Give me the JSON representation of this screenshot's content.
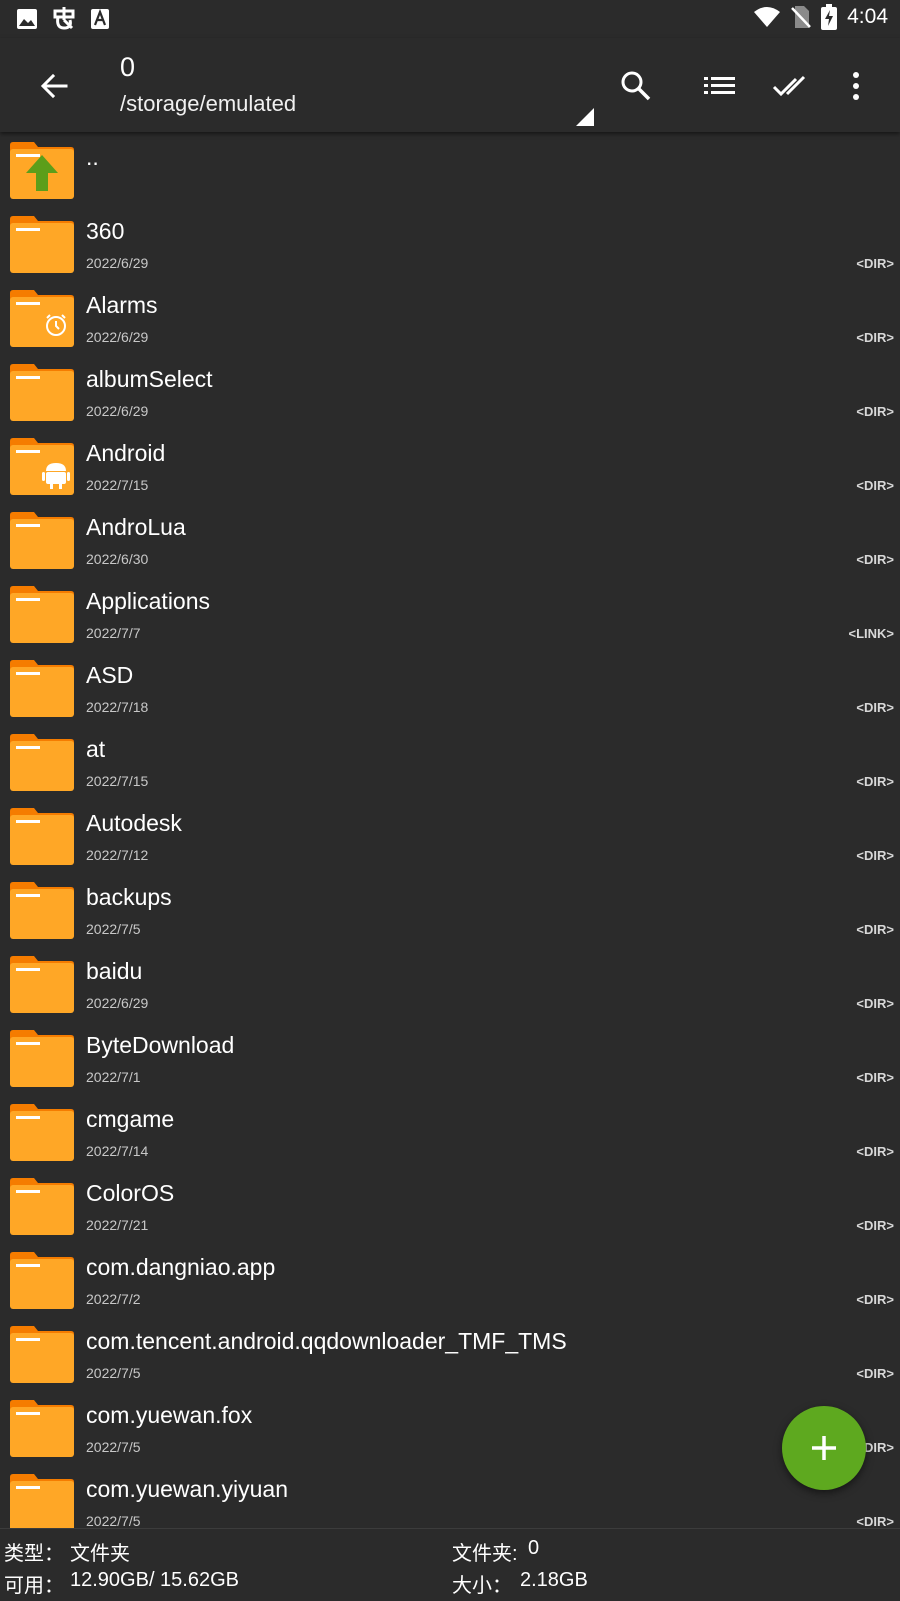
{
  "status": {
    "time": "4:04",
    "left_icons": [
      "image-icon",
      "bug-icon",
      "a-icon"
    ],
    "right_icons": [
      "wifi-icon",
      "no-sim-icon",
      "battery-charging-icon"
    ]
  },
  "appbar": {
    "title": "0",
    "path": "/storage/emulated",
    "actions": [
      "search-icon",
      "list-view-icon",
      "select-all-icon",
      "more-vert-icon"
    ]
  },
  "colors": {
    "background": "#2b2b2b",
    "folder": "#ffa726",
    "folder_tab": "#f57c00",
    "fab": "#5ea91f",
    "up_arrow": "#5c9e1a"
  },
  "files": [
    {
      "name": "..",
      "date": "",
      "type": "",
      "icon": "folder-up-icon"
    },
    {
      "name": "360",
      "date": "2022/6/29",
      "type": "<DIR>",
      "icon": "folder-icon"
    },
    {
      "name": "Alarms",
      "date": "2022/6/29",
      "type": "<DIR>",
      "icon": "folder-alarm-icon"
    },
    {
      "name": "albumSelect",
      "date": "2022/6/29",
      "type": "<DIR>",
      "icon": "folder-icon"
    },
    {
      "name": "Android",
      "date": "2022/7/15",
      "type": "<DIR>",
      "icon": "folder-android-icon"
    },
    {
      "name": "AndroLua",
      "date": "2022/6/30",
      "type": "<DIR>",
      "icon": "folder-icon"
    },
    {
      "name": "Applications",
      "date": "2022/7/7",
      "type": "<LINK>",
      "icon": "folder-icon"
    },
    {
      "name": "ASD",
      "date": "2022/7/18",
      "type": "<DIR>",
      "icon": "folder-icon"
    },
    {
      "name": "at",
      "date": "2022/7/15",
      "type": "<DIR>",
      "icon": "folder-icon"
    },
    {
      "name": "Autodesk",
      "date": "2022/7/12",
      "type": "<DIR>",
      "icon": "folder-icon"
    },
    {
      "name": "backups",
      "date": "2022/7/5",
      "type": "<DIR>",
      "icon": "folder-icon"
    },
    {
      "name": "baidu",
      "date": "2022/6/29",
      "type": "<DIR>",
      "icon": "folder-icon"
    },
    {
      "name": "ByteDownload",
      "date": "2022/7/1",
      "type": "<DIR>",
      "icon": "folder-icon"
    },
    {
      "name": "cmgame",
      "date": "2022/7/14",
      "type": "<DIR>",
      "icon": "folder-icon"
    },
    {
      "name": "ColorOS",
      "date": "2022/7/21",
      "type": "<DIR>",
      "icon": "folder-icon"
    },
    {
      "name": "com.dangniao.app",
      "date": "2022/7/2",
      "type": "<DIR>",
      "icon": "folder-icon"
    },
    {
      "name": "com.tencent.android.qqdownloader_TMF_TMS",
      "date": "2022/7/5",
      "type": "<DIR>",
      "icon": "folder-icon"
    },
    {
      "name": "com.yuewan.fox",
      "date": "2022/7/5",
      "type": "<DIR>",
      "icon": "folder-icon"
    },
    {
      "name": "com.yuewan.yiyuan",
      "date": "2022/7/5",
      "type": "<DIR>",
      "icon": "folder-icon"
    }
  ],
  "fab": {
    "icon": "plus-icon"
  },
  "footer": {
    "type_label": "类型：",
    "type_value": "文件夹",
    "folders_label": "文件夹:",
    "folders_value": "0",
    "free_label": "可用：",
    "free_value": "12.90GB/ 15.62GB",
    "size_label": "大小：",
    "size_value": "2.18GB"
  }
}
